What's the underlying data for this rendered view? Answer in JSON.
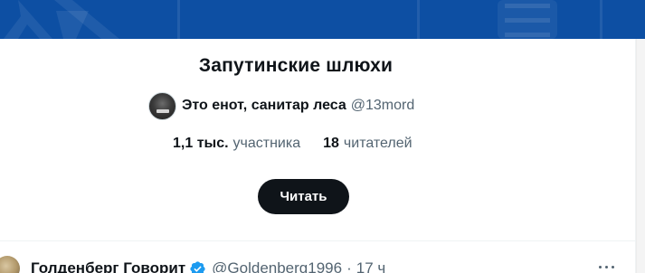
{
  "list": {
    "title": "Запутинские шлюхи",
    "owner_name": "Это енот, санитар леса",
    "owner_handle": "@13mord",
    "members_count": "1,1 тыс.",
    "members_label": "участника",
    "followers_count": "18",
    "followers_label": "читателей",
    "follow_label": "Читать"
  },
  "tweet": {
    "author": "Голденберг Говорит",
    "handle": "@Goldenberg1996",
    "separator": "·",
    "time": "17 ч"
  },
  "colors": {
    "banner": "#0d4fa3",
    "button_bg": "#0f1419",
    "secondary_text": "#536471",
    "verified": "#1d9bf0"
  },
  "icons": {
    "banner_logo": "x-logo-icon",
    "banner_menu": "menu-icon",
    "verified": "verified-badge-icon",
    "more": "more-icon"
  }
}
